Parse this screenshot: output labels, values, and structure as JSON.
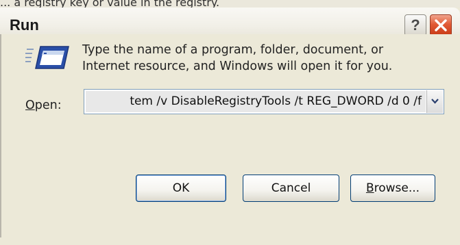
{
  "top_strip": {
    "text": "... a registry key or value in the registry."
  },
  "window": {
    "title": "Run",
    "help_label": "?"
  },
  "dialog": {
    "description_line1": "Type the name of a program, folder, document, or",
    "description_line2": "Internet resource, and Windows will open it for you.",
    "open_label_mnemonic": "O",
    "open_label_rest": "pen:",
    "open_value": "tem /v DisableRegistryTools /t REG_DWORD /d 0 /f",
    "buttons": {
      "ok": "OK",
      "cancel": "Cancel",
      "browse_mnemonic": "B",
      "browse_rest": "rowse..."
    }
  },
  "colors": {
    "dialog_bg": "#ece9d8",
    "close_button": "#e25a35",
    "button_border": "#003c74",
    "combo_border": "#7f9db9"
  },
  "icons": {
    "run": "run-icon",
    "help": "question-mark-icon",
    "close": "close-icon",
    "dropdown": "chevron-down-icon"
  }
}
